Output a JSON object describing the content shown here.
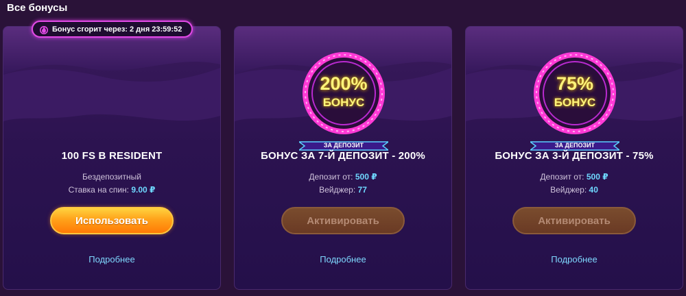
{
  "section_title": "Все бонусы",
  "timer": {
    "label": "Бонус сгорит через: 2 дня 23:59:52"
  },
  "cards": [
    {
      "title": "100 FS В RESIDENT",
      "line1": "Бездепозитный",
      "line2_label": "Ставка на спин:",
      "line2_value": "9.00 ₽",
      "button": "Использовать",
      "more": "Подробнее"
    },
    {
      "badge_main": "200%",
      "badge_sub": "БОНУС",
      "badge_ribbon": "ЗА ДЕПОЗИТ",
      "title": "БОНУС ЗА 7-Й ДЕПОЗИТ - 200%",
      "line1_label": "Депозит от:",
      "line1_value": "500 ₽",
      "line2_label": "Вейджер:",
      "line2_value": "77",
      "button": "Активировать",
      "more": "Подробнее"
    },
    {
      "badge_main": "75%",
      "badge_sub": "БОНУС",
      "badge_ribbon": "ЗА ДЕПОЗИТ",
      "title": "БОНУС ЗА 3-Й ДЕПОЗИТ - 75%",
      "line1_label": "Депозит от:",
      "line1_value": "500 ₽",
      "line2_label": "Вейджер:",
      "line2_value": "40",
      "button": "Активировать",
      "more": "Подробнее"
    }
  ],
  "colors": {
    "background": "#2a1238",
    "accent_blue": "#6fd8ff",
    "active_button": "#ffa21a",
    "neon_pink": "#e24ae6",
    "badge_yellow": "#fff47a"
  },
  "icons": {
    "timer": "fire-icon"
  }
}
